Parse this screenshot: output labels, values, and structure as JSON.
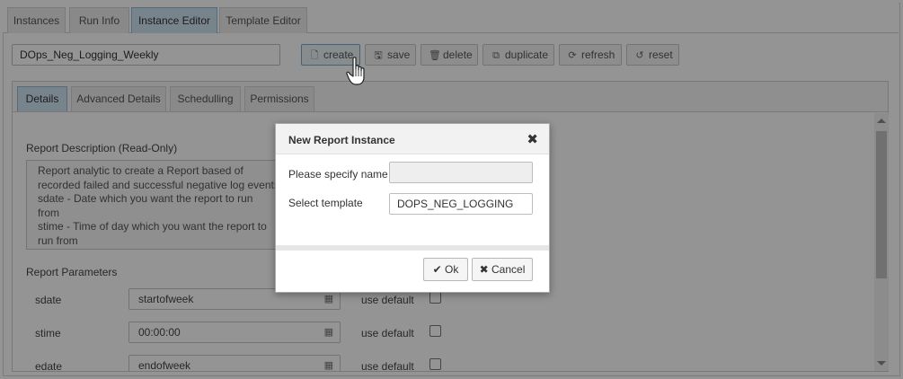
{
  "top_tabs": [
    {
      "label": "Instances",
      "active": false
    },
    {
      "label": "Run Info",
      "active": false
    },
    {
      "label": "Instance Editor",
      "active": true
    },
    {
      "label": "Template Editor",
      "active": false
    }
  ],
  "toolbar": {
    "instance_name_value": "DOps_Neg_Logging_Weekly",
    "create_label": "create",
    "save_label": "save",
    "delete_label": "delete",
    "duplicate_label": "duplicate",
    "refresh_label": "refresh",
    "reset_label": "reset"
  },
  "inner_tabs": [
    {
      "label": "Details",
      "active": true
    },
    {
      "label": "Advanced Details",
      "active": false
    },
    {
      "label": "Schedulling",
      "active": false
    },
    {
      "label": "Permissions",
      "active": false
    }
  ],
  "details": {
    "description_label": "Report Description (Read-Only)",
    "description_lines": [
      "Report analytic to create a Report based of",
      "recorded failed and successful negative log events.",
      "sdate - Date which you want the report to run",
      "from",
      "stime - Time of day which you want the report to",
      "run from"
    ],
    "parameters_label": "Report Parameters",
    "use_default_label": "use default",
    "params": [
      {
        "name": "sdate",
        "value": "startofweek"
      },
      {
        "name": "stime",
        "value": "00:00:00"
      },
      {
        "name": "edate",
        "value": "endofweek"
      }
    ]
  },
  "modal": {
    "title": "New Report Instance",
    "name_label": "Please specify name",
    "name_value": "",
    "template_label": "Select template",
    "template_value": "DOPS_NEG_LOGGING",
    "ok_label": "Ok",
    "cancel_label": "Cancel"
  },
  "icons": {
    "create": "file-icon",
    "save": "floppy-icon",
    "delete": "trash-icon",
    "duplicate": "copy-icon",
    "refresh": "refresh-icon",
    "reset": "undo-icon",
    "calendar": "calendar-icon",
    "close": "close-icon",
    "ok": "check-icon",
    "cancel": "x-icon"
  },
  "colors": {
    "active_tab": "#cfe4f1",
    "overlay": "rgba(0,0,0,0.42)"
  }
}
